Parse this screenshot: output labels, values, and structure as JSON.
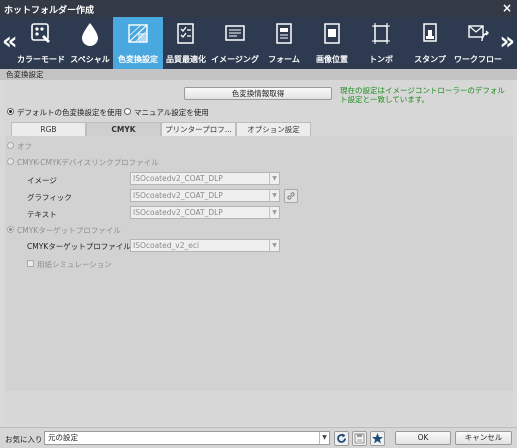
{
  "window": {
    "title": "ホットフォルダー作成",
    "close_icon": "×"
  },
  "toolbar": {
    "left_arrow": "«",
    "right_arrow": "»",
    "items": [
      {
        "label": "カラーモード",
        "icon": "palette-icon"
      },
      {
        "label": "スペシャル",
        "icon": "drop-icon"
      },
      {
        "label": "色変換設定",
        "icon": "color-conversion-icon",
        "active": true
      },
      {
        "label": "品質最適化",
        "icon": "checklist-icon"
      },
      {
        "label": "イメージング",
        "icon": "imaging-icon"
      },
      {
        "label": "フォーム",
        "icon": "form-icon"
      },
      {
        "label": "画像位置",
        "icon": "image-position-icon"
      },
      {
        "label": "トンボ",
        "icon": "crop-marks-icon"
      },
      {
        "label": "スタンプ",
        "icon": "stamp-icon"
      },
      {
        "label": "ワークフロー",
        "icon": "workflow-icon"
      }
    ]
  },
  "section": {
    "title": "色変換設定",
    "get_info_button": "色変換情報取得",
    "notice": "現在の設定はイメージコントローラーのデフォルト設定と一致しています。",
    "mode_default": "デフォルトの色変換設定を使用",
    "mode_manual": "マニュアル設定を使用"
  },
  "tabs": [
    {
      "label": "RGB"
    },
    {
      "label": "CMYK",
      "active": true
    },
    {
      "label": "プリンタープロフ..."
    },
    {
      "label": "オプション設定"
    }
  ],
  "cmyk": {
    "off_label": "オフ",
    "devicelink_label": "CMYK-CMYKデバイスリンクプロファイル",
    "image_label": "イメージ",
    "image_value": "ISOcoatedv2_COAT_DLP",
    "graphic_label": "グラフィック",
    "graphic_value": "ISOcoatedv2_COAT_DLP",
    "text_label": "テキスト",
    "text_value": "ISOcoatedv2_COAT_DLP",
    "target_label": "CMYKターゲットプロファイル",
    "target_profile_label": "CMYKターゲットプロファイル",
    "target_profile_value": "ISOcoated_v2_eci",
    "paper_sim_label": "用紙シミュレーション"
  },
  "bottom": {
    "favorites_label": "お気に入り",
    "favorites_value": "元の設定",
    "ok_label": "OK",
    "cancel_label": "キャンセル"
  },
  "colors": {
    "title_bar": "#333a45",
    "toolbar": "#2d3a4f",
    "active_tab": "#4aa8e0",
    "notice_text": "#1c8c1c"
  }
}
